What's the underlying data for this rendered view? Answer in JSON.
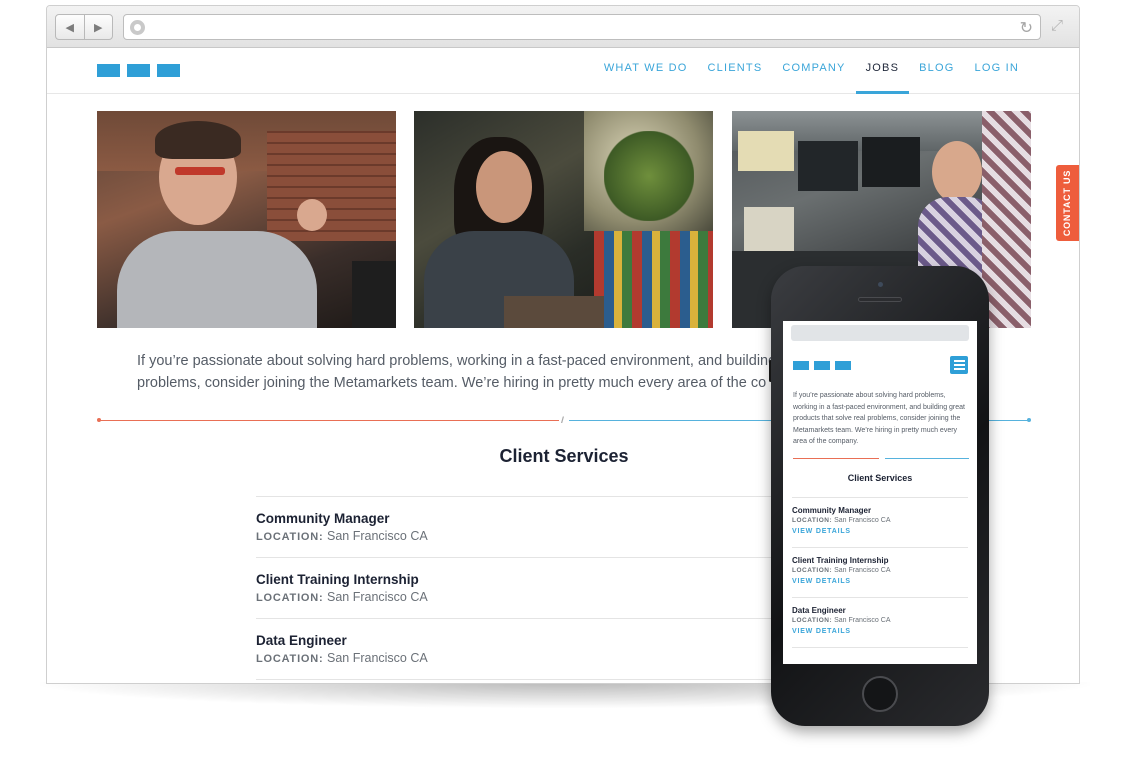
{
  "browser": {
    "back_icon": "back-arrow-icon",
    "forward_icon": "forward-arrow-icon",
    "url": "",
    "globe_icon": "globe-icon",
    "reload_icon": "reload-icon",
    "expand_icon": "expand-icon"
  },
  "header": {
    "nav": [
      {
        "label": "WHAT WE DO",
        "active": false
      },
      {
        "label": "CLIENTS",
        "active": false
      },
      {
        "label": "COMPANY",
        "active": false
      },
      {
        "label": "JOBS",
        "active": true
      },
      {
        "label": "BLOG",
        "active": false
      },
      {
        "label": "LOG IN",
        "active": false
      }
    ]
  },
  "intro": {
    "line1": "If you’re passionate about solving hard problems, working in a fast-paced environment, and building",
    "line2": "problems, consider joining the Metamarkets team. We’re hiring in pretty much every area of the co"
  },
  "section": {
    "title": "Client Services"
  },
  "jobs": [
    {
      "title": "Community Manager",
      "location_label": "LOCATION:",
      "location": "San Francisco CA"
    },
    {
      "title": "Client Training Internship",
      "location_label": "LOCATION:",
      "location": "San Francisco CA"
    },
    {
      "title": "Data Engineer",
      "location_label": "LOCATION:",
      "location": "San Francisco CA"
    }
  ],
  "contact_tab": {
    "label": "CONTACT US"
  },
  "mobile": {
    "intro": "If you’re passionate about solving hard problems, working in a fast-paced environment, and building great products that solve real problems, consider joining the Metamarkets team. We’re hiring in pretty much every area of the company.",
    "title": "Client Services",
    "view_details": "VIEW DETAILS",
    "menu_icon": "hamburger-menu-icon"
  },
  "colors": {
    "accent_blue": "#2f9fd7",
    "accent_red": "#ee5d3c",
    "heading": "#1c2233"
  }
}
